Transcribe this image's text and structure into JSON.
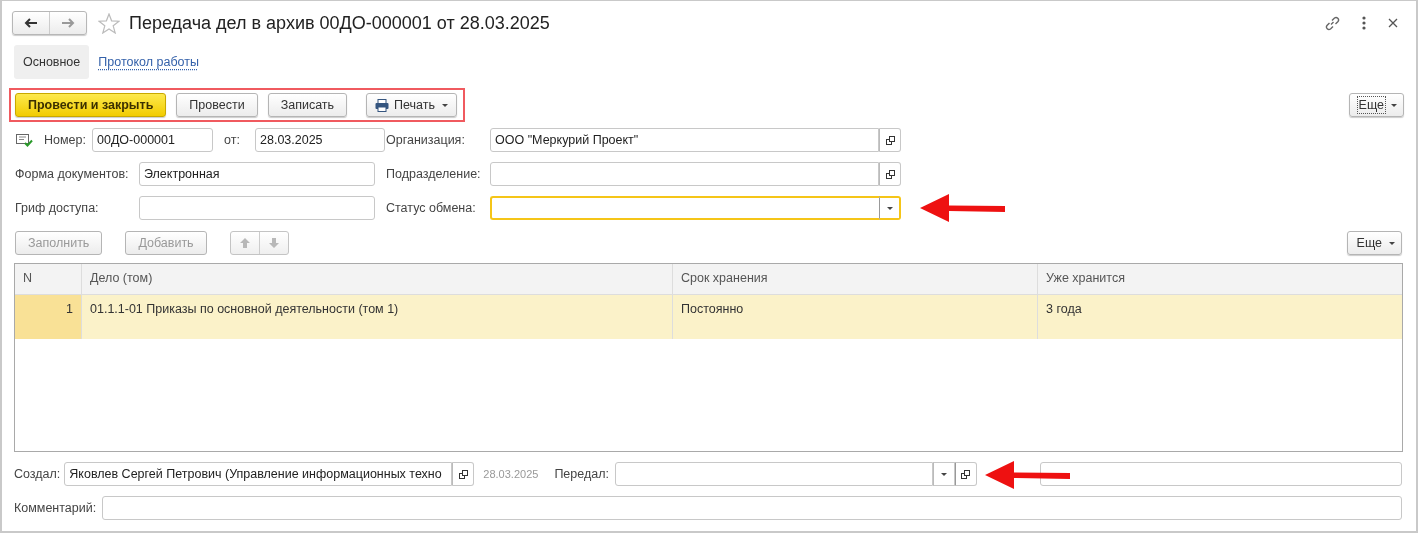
{
  "window": {
    "title": "Передача дел в архив 00ДО-000001 от 28.03.2025"
  },
  "tabs": [
    {
      "label": "Основное",
      "selected": true
    },
    {
      "label": "Протокол работы",
      "selected": false
    }
  ],
  "command_bar": {
    "highlighted": true,
    "buttons": [
      {
        "label": "Провести и закрыть",
        "kind": "primary"
      },
      {
        "label": "Провести",
        "kind": "plain"
      },
      {
        "label": "Записать",
        "kind": "plain"
      },
      {
        "label": "Печать",
        "kind": "print"
      }
    ],
    "more_button": "Еще"
  },
  "number": {
    "label": "Номер:",
    "value": "00ДО-000001"
  },
  "date": {
    "label": "от:",
    "value": "28.03.2025"
  },
  "left_fields": [
    {
      "label": "Форма документов:",
      "value": "Электронная"
    },
    {
      "label": "Гриф доступа:"
    }
  ],
  "right_fields": [
    {
      "label": "Организация:",
      "value": "ООО \"Меркурий Проект\"",
      "kind": "choice",
      "focused": false
    },
    {
      "label": "Подразделение:",
      "kind": "choice",
      "focused": false
    },
    {
      "label": "Статус обмена:",
      "kind": "dropdown",
      "focused": true
    }
  ],
  "table_toolbar": {
    "buttons": [
      {
        "label": "Заполнить",
        "disabled": true
      },
      {
        "label": "Добавить",
        "disabled": true
      }
    ],
    "move_buttons": [
      {
        "kind": "up",
        "disabled": true
      },
      {
        "kind": "down",
        "disabled": true
      }
    ],
    "more_button": "Еще"
  },
  "table": {
    "columns": [
      "N",
      "Дело (том)",
      "Срок хранения",
      "Уже хранится"
    ],
    "rows": [
      {
        "cells": [
          "1",
          "01.1.1-01 Приказы по основной деятельности (том 1)",
          "Постоянно",
          "3 года"
        ],
        "selected": true
      }
    ]
  },
  "created_by": {
    "label": "Создал:",
    "value": "Яковлев Сергей Петрович (Управление информационных техно",
    "date": "28.03.2025"
  },
  "transferred_by": {
    "label": "Передал:"
  },
  "comment": {
    "label": "Комментарий:"
  },
  "annotations": [
    {
      "kind": "arrow"
    },
    {
      "kind": "arrow"
    }
  ]
}
